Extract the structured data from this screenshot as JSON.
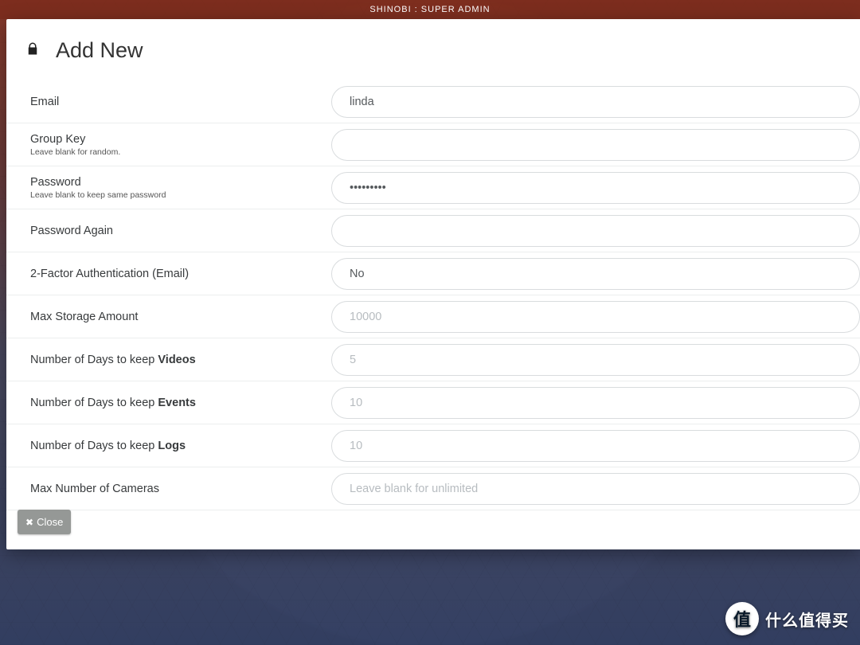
{
  "header": {
    "title": "SHINOBI : SUPER ADMIN"
  },
  "modal": {
    "title": "Add New",
    "fields": {
      "email": {
        "label": "Email",
        "value": "linda",
        "placeholder": ""
      },
      "group_key": {
        "label": "Group Key",
        "hint": "Leave blank for random.",
        "value": "",
        "placeholder": ""
      },
      "password": {
        "label": "Password",
        "hint": "Leave blank to keep same password",
        "value": "•••••••••",
        "placeholder": ""
      },
      "password_again": {
        "label": "Password Again",
        "value": "",
        "placeholder": ""
      },
      "twofactor": {
        "label": "2-Factor Authentication (Email)",
        "value": "No"
      },
      "max_storage": {
        "label": "Max Storage Amount",
        "value": "",
        "placeholder": "10000"
      },
      "days_videos": {
        "label_pre": "Number of Days to keep ",
        "label_bold": "Videos",
        "value": "",
        "placeholder": "5"
      },
      "days_events": {
        "label_pre": "Number of Days to keep ",
        "label_bold": "Events",
        "value": "",
        "placeholder": "10"
      },
      "days_logs": {
        "label_pre": "Number of Days to keep ",
        "label_bold": "Logs",
        "value": "",
        "placeholder": "10"
      },
      "max_cameras": {
        "label": "Max Number of Cameras",
        "value": "",
        "placeholder": "Leave blank for unlimited"
      }
    }
  },
  "buttons": {
    "close": "Close"
  },
  "watermark": {
    "glyph": "值",
    "text": "什么值得买"
  }
}
